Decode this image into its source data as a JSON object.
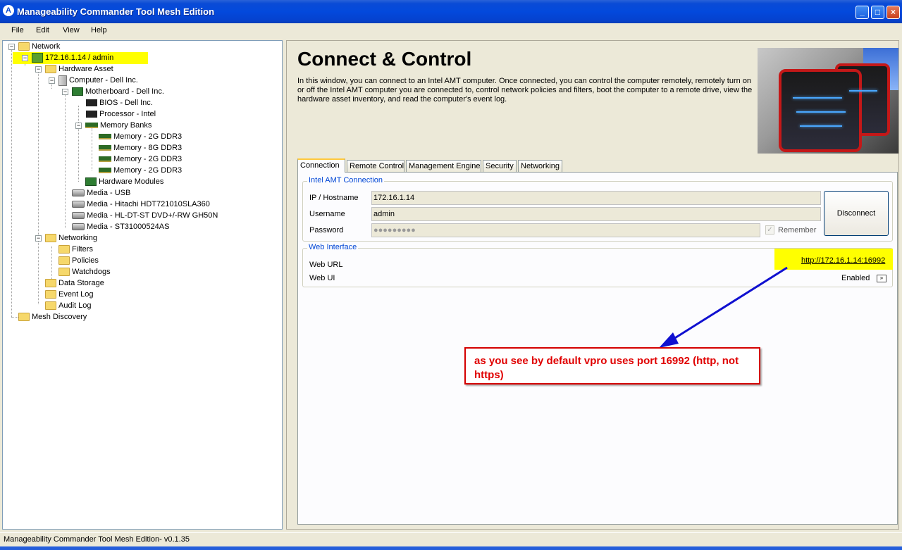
{
  "window": {
    "title": "Manageability Commander Tool Mesh Edition",
    "icon_letter": "A",
    "controls": {
      "minimize": "_",
      "maximize": "□",
      "close": "×"
    }
  },
  "menu": {
    "items": [
      "File",
      "Edit",
      "View",
      "Help"
    ]
  },
  "tree": {
    "network": "Network",
    "host": "172.16.1.14 / admin",
    "hardware_asset": "Hardware Asset",
    "computer": "Computer - Dell Inc.",
    "motherboard": "Motherboard - Dell Inc.",
    "bios": "BIOS - Dell Inc.",
    "processor": "Processor - Intel",
    "memory_banks": "Memory Banks",
    "memory": [
      "Memory - 2G DDR3",
      "Memory - 8G DDR3",
      "Memory - 2G DDR3",
      "Memory - 2G DDR3"
    ],
    "hardware_modules": "Hardware Modules",
    "media": [
      "Media - USB",
      "Media - Hitachi HDT721010SLA360",
      "Media - HL-DT-ST DVD+/-RW GH50N",
      "Media - ST31000524AS"
    ],
    "networking": "Networking",
    "filters": "Filters",
    "policies": "Policies",
    "watchdogs": "Watchdogs",
    "data_storage": "Data Storage",
    "event_log": "Event Log",
    "audit_log": "Audit Log",
    "mesh_discovery": "Mesh Discovery"
  },
  "main": {
    "heading": "Connect & Control",
    "description": "In this window, you can connect to an Intel AMT computer. Once connected, you can control the computer remotely, remotely turn on or off the Intel AMT computer you are connected to, control network policies and filters, boot the computer to a remote drive, view the hardware asset inventory, and read the computer's event log.",
    "tabs": [
      "Connection",
      "Remote Control",
      "Management Engine",
      "Security",
      "Networking"
    ]
  },
  "connection": {
    "group_title": "Intel AMT Connection",
    "ip_label": "IP / Hostname",
    "ip_value": "172.16.1.14",
    "username_label": "Username",
    "username_value": "admin",
    "password_label": "Password",
    "password_value": "●●●●●●●●●",
    "remember_label": "Remember",
    "remember_checked": true,
    "disconnect_button": "Disconnect"
  },
  "web_interface": {
    "group_title": "Web Interface",
    "url_label": "Web URL",
    "url_value": "http://172.16.1.14:16992",
    "ui_label": "Web UI",
    "ui_value": "Enabled",
    "ui_toggle": "»"
  },
  "annotation": {
    "text": "as you see by default vpro uses port 16992 (http, not https)",
    "highlight_color": "#ffff00",
    "arrow_color": "#1010d0",
    "border_color": "#d40000"
  },
  "status": {
    "text": "Manageability Commander Tool Mesh Edition- v0.1.35"
  }
}
